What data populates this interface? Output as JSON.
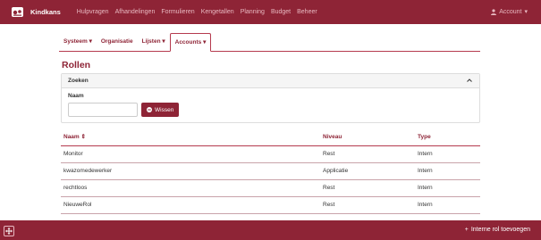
{
  "topbar": {
    "brand": "Kindkans",
    "nav": [
      "Hulpvragen",
      "Afhandelingen",
      "Formulieren",
      "Kengetallen",
      "Planning",
      "Budget",
      "Beheer"
    ],
    "account": "Account"
  },
  "tabs": [
    {
      "label": "Systeem",
      "dropdown": true,
      "active": false
    },
    {
      "label": "Organisatie",
      "dropdown": false,
      "active": false
    },
    {
      "label": "Lijsten",
      "dropdown": true,
      "active": false
    },
    {
      "label": "Accounts",
      "dropdown": true,
      "active": true
    }
  ],
  "page": {
    "title": "Rollen"
  },
  "search": {
    "title": "Zoeken",
    "name_label": "Naam",
    "name_value": "",
    "clear_button": "Wissen"
  },
  "table": {
    "headers": [
      "Naam",
      "Niveau",
      "Type"
    ],
    "rows": [
      [
        "Monitor",
        "Rest",
        "Intern"
      ],
      [
        "kwazomedewerker",
        "Applicatie",
        "Intern"
      ],
      [
        "rechtloos",
        "Rest",
        "Intern"
      ],
      [
        "NieuweRol",
        "Rest",
        "Intern"
      ]
    ]
  },
  "footer": {
    "add_role": "Interne rol toevoegen"
  },
  "colors": {
    "brand": "#8e2436",
    "link": "#8e2436",
    "divider": "#b53a4e"
  }
}
